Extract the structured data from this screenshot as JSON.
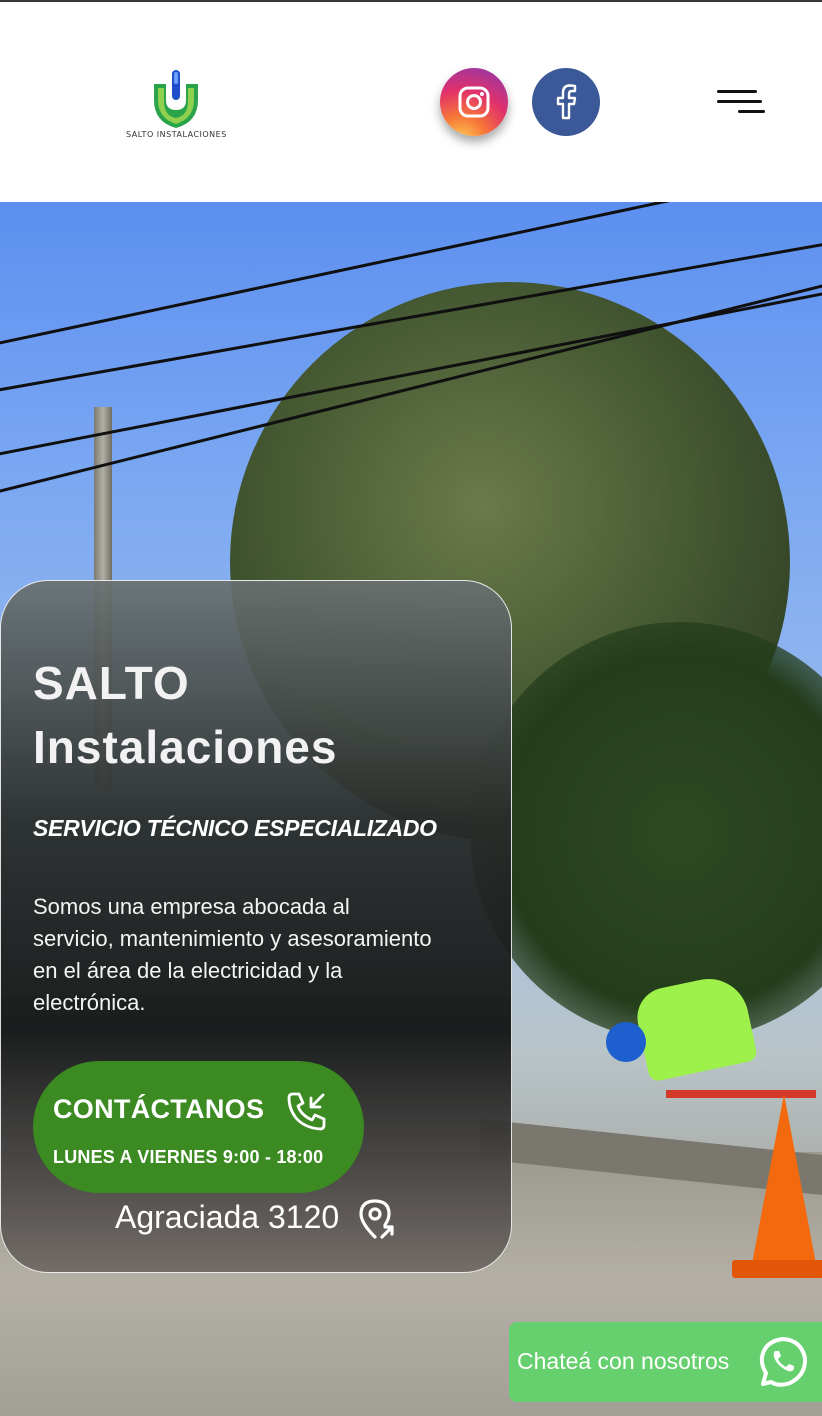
{
  "header": {
    "logo": {
      "icon": "shield-plug-logo",
      "text": "SALTO INSTALACIONES"
    },
    "social": [
      {
        "name": "instagram",
        "icon": "instagram-icon",
        "color": "#e1306c"
      },
      {
        "name": "facebook",
        "icon": "facebook-icon",
        "color": "#3b5998"
      }
    ],
    "menu_icon": "hamburger-menu-icon"
  },
  "hero": {
    "title": "SALTO Instalaciones",
    "subtitle": "SERVICIO TÉCNICO ESPECIALIZADO",
    "description": "Somos una empresa abocada al servicio, mantenimiento y asesoramiento en el área de la electricidad y la electrónica.",
    "contact_button": {
      "label": "CONTÁCTANOS",
      "icon": "phone-incoming-icon",
      "hours": "LUNES A VIERNES 9:00 - 18:00",
      "color": "#3b8a22"
    },
    "address": {
      "text": "Agraciada 3120",
      "icon": "map-pin-icon"
    }
  },
  "chat_widget": {
    "label": "Chateá con nosotros",
    "icon": "whatsapp-icon",
    "color": "#66cf6e"
  }
}
